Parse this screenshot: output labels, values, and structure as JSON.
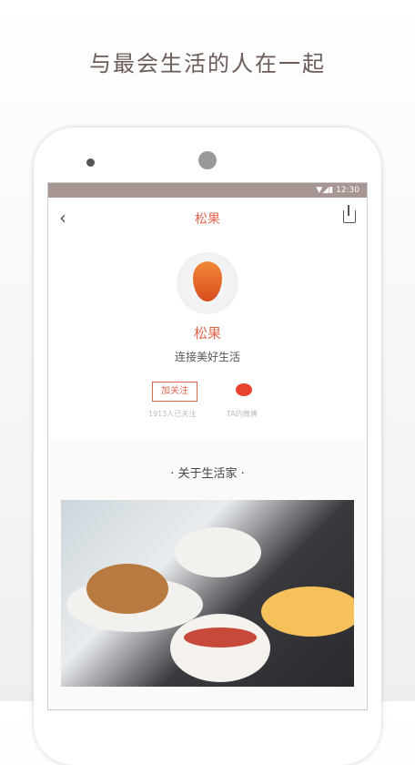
{
  "headline": "与最会生活的人在一起",
  "status": {
    "time": "12:30",
    "icons": [
      "wifi-icon",
      "signal-icon",
      "battery-icon"
    ]
  },
  "topbar": {
    "title": "松果",
    "back": "‹"
  },
  "profile": {
    "name": "松果",
    "tagline": "连接美好生活",
    "follow_label": "加关注",
    "followers": "1913人已关注",
    "weibo_label": "TA的微博"
  },
  "section": {
    "title": "· 关于生活家 ·"
  },
  "colors": {
    "accent": "#e0674f",
    "statusbar": "#a69593"
  }
}
